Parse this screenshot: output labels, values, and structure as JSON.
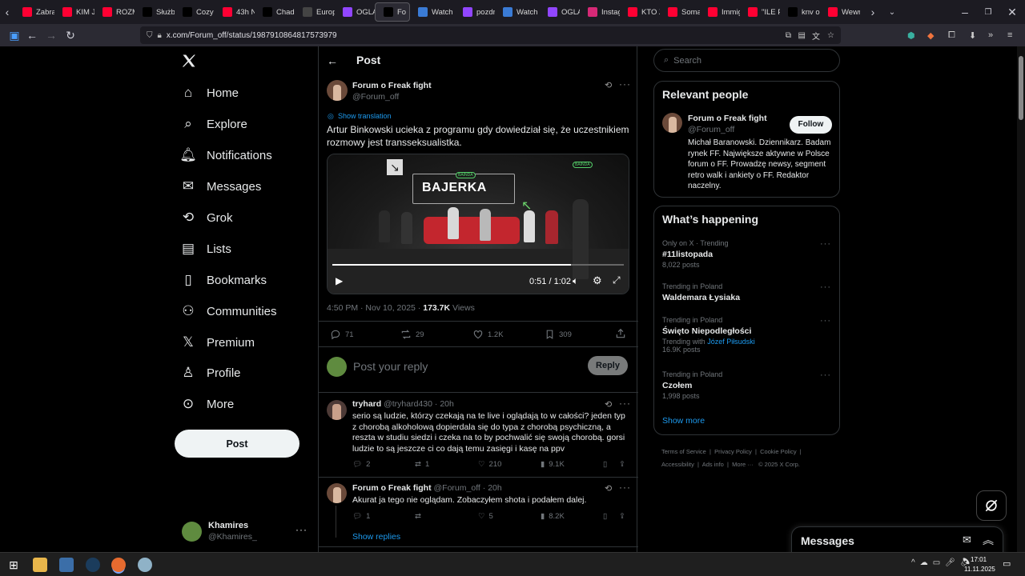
{
  "browser": {
    "tabs": [
      {
        "label": "Zabra",
        "icon": "youtube-icon",
        "color": "#ff0033"
      },
      {
        "label": "KIM JI",
        "icon": "youtube-icon",
        "color": "#ff0033"
      },
      {
        "label": "ROZM",
        "icon": "youtube-icon",
        "color": "#ff0033"
      },
      {
        "label": "Służb",
        "icon": "x-icon",
        "color": "#000000"
      },
      {
        "label": "Cozy",
        "icon": "x-icon",
        "color": "#000000"
      },
      {
        "label": "43h N",
        "icon": "youtube-icon",
        "color": "#ff0033"
      },
      {
        "label": "Chad",
        "icon": "x-icon",
        "color": "#000000"
      },
      {
        "label": "Europ",
        "icon": "globe-icon",
        "color": "#444444"
      },
      {
        "label": "OGLĄ",
        "icon": "twitch-icon",
        "color": "#9146ff"
      },
      {
        "label": "Fo",
        "icon": "x-icon",
        "color": "#000000"
      },
      {
        "label": "Watch",
        "icon": "kick-icon",
        "color": "#3a7bd5"
      },
      {
        "label": "pozdr",
        "icon": "twitch-icon",
        "color": "#9146ff"
      },
      {
        "label": "Watch",
        "icon": "kick-icon",
        "color": "#3a7bd5"
      },
      {
        "label": "OGLĄ",
        "icon": "twitch-icon",
        "color": "#9146ff"
      },
      {
        "label": "Instag",
        "icon": "instagram-icon",
        "color": "#d62976"
      },
      {
        "label": "KTO Z",
        "icon": "youtube-icon",
        "color": "#ff0033"
      },
      {
        "label": "Soma",
        "icon": "youtube-icon",
        "color": "#ff0033"
      },
      {
        "label": "Immig",
        "icon": "youtube-icon",
        "color": "#ff0033"
      },
      {
        "label": "\"ILE P",
        "icon": "youtube-icon",
        "color": "#ff0033"
      },
      {
        "label": "knv o",
        "icon": "x-icon",
        "color": "#000000"
      },
      {
        "label": "Wewn",
        "icon": "youtube-icon",
        "color": "#ff0033"
      }
    ],
    "url": "x.com/Forum_off/status/1987910864817573979"
  },
  "nav": {
    "items": [
      {
        "label": "Home",
        "icon": "home-icon"
      },
      {
        "label": "Explore",
        "icon": "search-icon"
      },
      {
        "label": "Notifications",
        "icon": "bell-icon"
      },
      {
        "label": "Messages",
        "icon": "mail-icon"
      },
      {
        "label": "Grok",
        "icon": "grok-icon"
      },
      {
        "label": "Lists",
        "icon": "list-icon"
      },
      {
        "label": "Bookmarks",
        "icon": "bookmark-icon"
      },
      {
        "label": "Communities",
        "icon": "communities-icon"
      },
      {
        "label": "Premium",
        "icon": "x-logo-icon"
      },
      {
        "label": "Profile",
        "icon": "person-icon"
      },
      {
        "label": "More",
        "icon": "more-circle-icon"
      }
    ],
    "post_button": "Post",
    "account": {
      "name": "Khamires",
      "handle": "@Khamires_"
    }
  },
  "post": {
    "header": "Post",
    "author": {
      "name": "Forum o Freak fight",
      "handle": "@Forum_off"
    },
    "show_translation": "Show translation",
    "text": "Artur Binkowski ucieka z programu gdy dowiedział się, że uczestnikiem rozmowy jest transseksualistka.",
    "video": {
      "title": "BAJERKA",
      "brand": "BAINDA",
      "time": "0:51 / 1:02",
      "progress": 0.82
    },
    "timestamp": "4:50 PM · Nov 10, 2025 · ",
    "views_count": "173.7K",
    "views_label": " Views",
    "stats": {
      "replies": "71",
      "reposts": "29",
      "likes": "1.2K",
      "bookmarks": "309"
    },
    "reply_placeholder": "Post your reply",
    "reply_button": "Reply"
  },
  "replies": [
    {
      "name": "tryhard",
      "handle": "@tryhard430",
      "time": "20h",
      "text": "serio są ludzie, którzy czekają na te live i oglądają to w całości? jeden typ z chorobą alkoholową dopierdala się do typa z chorobą psychiczną, a reszta w studiu siedzi i czeka na to by pochwalić się swoją chorobą. gorsi ludzie to są jeszcze ci co dają temu zasięgi i kasę na ppv",
      "replies": "2",
      "reposts": "1",
      "likes": "210",
      "views": "9.1K"
    },
    {
      "name": "Forum o Freak fight",
      "handle": "@Forum_off",
      "time": "20h",
      "text": "Akurat ja tego nie oglądam. Zobaczyłem shota i podałem dalej.",
      "replies": "1",
      "reposts": "",
      "likes": "5",
      "views": "8.2K",
      "show_replies": "Show replies"
    }
  ],
  "sidebar": {
    "search_placeholder": "Search",
    "relevant": {
      "title": "Relevant people",
      "name": "Forum o Freak fight",
      "handle": "@Forum_off",
      "follow": "Follow",
      "bio": "Michał Baranowski. Dziennikarz. Badam rynek FF. Największe aktywne w Polsce forum o FF. Prowadzę newsy, segment retro walk i ankiety o FF. Redaktor naczelny."
    },
    "happening": {
      "title": "What’s happening",
      "trends": [
        {
          "context": "Only on X · Trending",
          "name": "#11listopada",
          "posts": "8,022 posts"
        },
        {
          "context": "Trending in Poland",
          "name": "Waldemara Łysiaka",
          "posts": ""
        },
        {
          "context": "Trending in Poland",
          "name": "Święto Niepodległości",
          "with_label": "Trending with ",
          "with_link": "Józef Piłsudski",
          "posts": "16.9K posts"
        },
        {
          "context": "Trending in Poland",
          "name": "Czołem",
          "posts": "1,998 posts"
        }
      ],
      "show_more": "Show more"
    },
    "footer": [
      "Terms of Service",
      "Privacy Policy",
      "Cookie Policy",
      "Accessibility",
      "Ads info",
      "More ···",
      "© 2025 X Corp."
    ],
    "messages": "Messages"
  },
  "taskbar": {
    "time": "17:01",
    "date": "11.11.2025"
  }
}
